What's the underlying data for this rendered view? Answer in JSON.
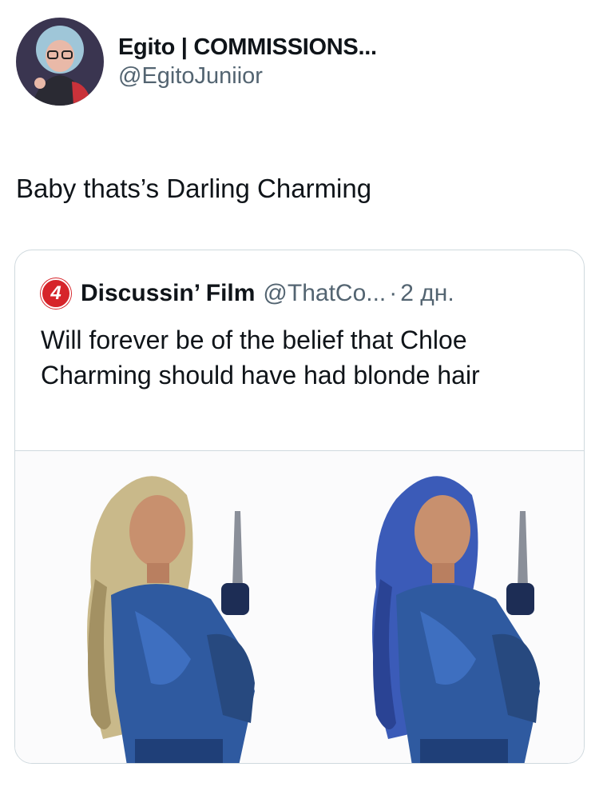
{
  "author": {
    "display_name": "Egito | COMMISSIONS...",
    "handle": "@EgitoJuniior",
    "avatar_icon": "cartoon-avatar"
  },
  "tweet": {
    "text": "Baby thats’s Darling Charming"
  },
  "quoted_tweet": {
    "avatar_icon": "discussing-film-logo",
    "avatar_glyph": "4",
    "display_name": "Discussin’ Film",
    "handle": "@ThatCo...",
    "separator": "·",
    "time": "2 дн.",
    "text": "Will forever be of the belief that Chloe Charming should have had blonde hair",
    "media": [
      {
        "name": "blonde-hair-version",
        "hair_color": "#c9b98a"
      },
      {
        "name": "blue-hair-version",
        "hair_color": "#3b5bb8"
      }
    ]
  },
  "colors": {
    "text_primary": "#0f1419",
    "text_secondary": "#536471",
    "border": "#cfd9de",
    "brand_red": "#d6242a"
  }
}
